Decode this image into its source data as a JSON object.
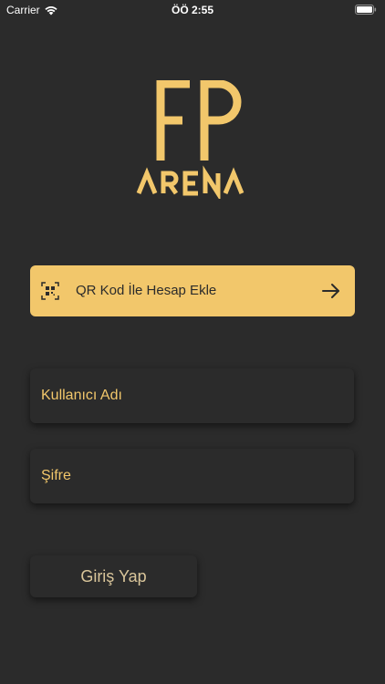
{
  "status_bar": {
    "carrier": "Carrier",
    "time": "ÖÖ 2:55"
  },
  "logo": {
    "line1": "FP",
    "line2": "ARENA",
    "color": "#f2c76b"
  },
  "qr_button": {
    "label": "QR Kod İle Hesap Ekle",
    "icon": "qr-scan-icon",
    "trailing_icon": "arrow-right-icon",
    "background": "#f2c76b"
  },
  "form": {
    "username_placeholder": "Kullanıcı Adı",
    "password_placeholder": "Şifre",
    "login_label": "Giriş Yap"
  },
  "colors": {
    "background": "#2b2b2b",
    "accent": "#f2c76b"
  }
}
